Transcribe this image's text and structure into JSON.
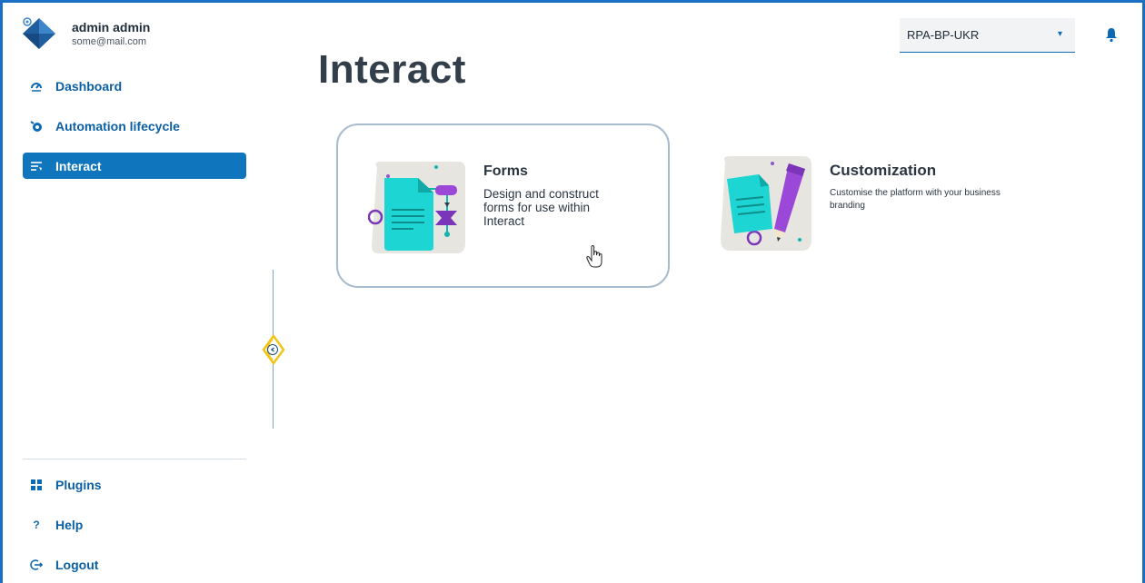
{
  "user": {
    "name": "admin admin",
    "email": "some@mail.com"
  },
  "nav": {
    "top": [
      {
        "label": "Dashboard",
        "icon": "dashboard-icon",
        "active": false
      },
      {
        "label": "Automation lifecycle",
        "icon": "lifecycle-icon",
        "active": false
      },
      {
        "label": "Interact",
        "icon": "interact-icon",
        "active": true
      }
    ],
    "bottom": [
      {
        "label": "Plugins",
        "icon": "plugins-icon",
        "glyph": "■"
      },
      {
        "label": "Help",
        "icon": "help-icon",
        "glyph": "?"
      },
      {
        "label": "Logout",
        "icon": "logout-icon",
        "glyph": "↦"
      }
    ]
  },
  "header": {
    "tenant": "RPA-BP-UKR"
  },
  "page": {
    "title": "Interact"
  },
  "cards": {
    "forms": {
      "title": "Forms",
      "description": "Design and construct forms for use within Interact"
    },
    "customization": {
      "title": "Customization",
      "description": "Customise the platform with your business branding"
    }
  },
  "colors": {
    "accent": "#0f75bc",
    "nav_text": "#0b5fa5",
    "frame": "#1a6fc2",
    "card_border": "#a7bccf",
    "highlight": "#f0c419"
  }
}
